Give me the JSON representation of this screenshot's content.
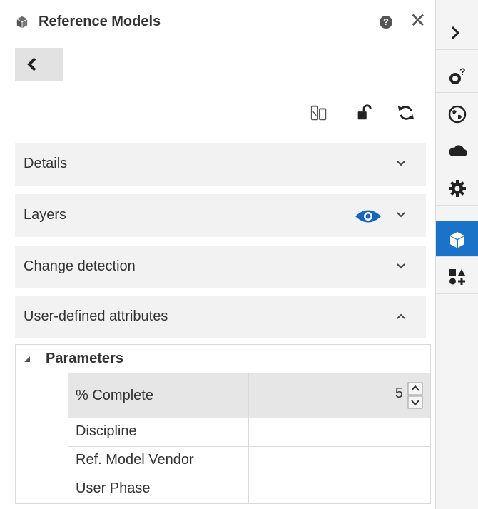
{
  "header": {
    "title": "Reference Models",
    "help_glyph": "?",
    "close_glyph": "✕"
  },
  "sections": [
    {
      "label": "Details",
      "expanded": false
    },
    {
      "label": "Layers",
      "expanded": false
    },
    {
      "label": "Change detection",
      "expanded": false
    },
    {
      "label": "User-defined attributes",
      "expanded": true
    }
  ],
  "parameters": {
    "group_label": "Parameters",
    "rows": [
      {
        "name": "% Complete",
        "value": "5",
        "selected": true
      },
      {
        "name": "Discipline",
        "value": ""
      },
      {
        "name": "Ref. Model Vendor",
        "value": ""
      },
      {
        "name": "User Phase",
        "value": ""
      }
    ]
  },
  "rail": {
    "items": [
      "collapse-chevron",
      "settings-help-icon",
      "globe-icon",
      "cloud-icon",
      "gear-icon",
      "cube-icon",
      "shapes-add-icon"
    ],
    "active": "cube-icon"
  },
  "colors": {
    "accent": "#1a73c8",
    "eye": "#1565c0",
    "section_bg": "#f2f2f2",
    "selected_row": "#e6e6e6"
  }
}
